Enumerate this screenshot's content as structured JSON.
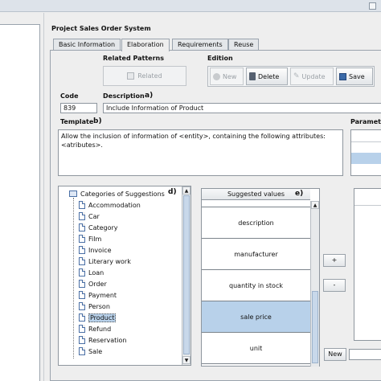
{
  "project": {
    "label": "Project  Sales Order System"
  },
  "tabs": [
    {
      "label": "Basic Information"
    },
    {
      "label": "Elaboration"
    },
    {
      "label": "Requirements"
    },
    {
      "label": "Reuse"
    }
  ],
  "related_patterns": {
    "heading": "Related Patterns",
    "button": "Related"
  },
  "edition": {
    "heading": "Edition",
    "new": "New",
    "delete": "Delete",
    "update": "Update",
    "save": "Save"
  },
  "code": {
    "label": "Code",
    "value": "839"
  },
  "description": {
    "label": "Description",
    "annotation": "a)",
    "value": "Include Information of Product"
  },
  "template": {
    "label": "Template",
    "annotation": "b)",
    "line1": "Allow the inclusion of information of <entity>, containing the following attributes:",
    "line2": "<atributes>."
  },
  "parameters": {
    "label": "Paramete"
  },
  "tree": {
    "root": "Categories of Suggestions",
    "annotation": "d)",
    "items": [
      "Accommodation",
      "Car",
      "Category",
      "Film",
      "Invoice",
      "Literary work",
      "Loan",
      "Order",
      "Payment",
      "Person",
      "Product",
      "Refund",
      "Reservation",
      "Sale"
    ],
    "selected": "Product"
  },
  "suggested": {
    "header": "Suggested values",
    "annotation": "e)",
    "values": [
      "description",
      "manufacturer",
      "quantity in stock",
      "sale price",
      "unit"
    ],
    "selected": "sale price"
  },
  "controls": {
    "plus": "+",
    "minus": "-",
    "new": "New"
  },
  "colors": {
    "selection": "#b8d1ea",
    "accent": "#4a6fa5"
  }
}
